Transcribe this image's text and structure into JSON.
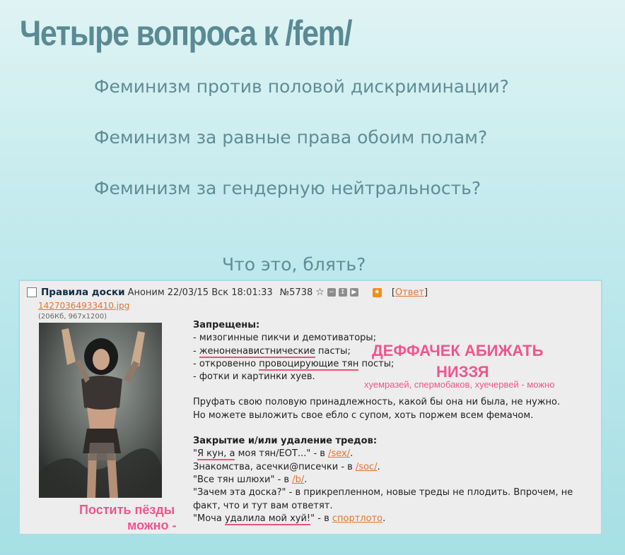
{
  "page": {
    "title": "Четыре вопроса к /fem/",
    "questions": [
      "Феминизм против половой дискриминации?",
      "Феминизм за равные права обоим полам?",
      "Феминизм за гендерную нейтральность?"
    ],
    "what_is_this": "Что это, блять?"
  },
  "post": {
    "subject": "Правила доски",
    "name": "Аноним",
    "datetime": "22/03/15 Вск 18:01:33",
    "number": "№5738",
    "reply_open": "[",
    "reply_label": "Ответ",
    "reply_close": "]",
    "file_name": "14270364933410.jpg",
    "file_meta": "(206Кб, 967x1200)",
    "icons": [
      "checkbox-icon",
      "star-icon",
      "hide-icon",
      "expand-icon",
      "play-icon",
      "favorite-icon"
    ],
    "body": {
      "forbidden_header": "Запрещены:",
      "f1": "- мизогинные пикчи и демотиваторы;",
      "f2a": "- ",
      "f2u": "женоненавистнические",
      "f2b": " пасты;",
      "f3a": "- откровенно ",
      "f3u": "провоцирующие тян",
      "f3b": " посты;",
      "f4": "- фотки и картинки хуев.",
      "para1": "Пруфать свою половую принадлежность, какой бы она ни была, не нужно.",
      "para2": "Но можете выложить свое ебло с супом, хоть поржем всем фемачом.",
      "closing_header": "Закрытие и/или удаление тредов:",
      "c1a": "\"",
      "c1u": "Я кун, а",
      "c1b": " моя тян/ЕОТ...\" - в ",
      "c1link": "/sex/",
      "c1end": ".",
      "c2a": "Знакомства, асечки@писечки - в ",
      "c2link": "/soc/",
      "c2end": ".",
      "c3a": "\"Все тян шлюхи\" - в ",
      "c3link": "/b/",
      "c3end": ".",
      "c4a": "\"Зачем эта доска?\" - в прикрепленном, новые треды не плодить. Впрочем, не",
      "c4b": "факт, что и тут вам ответят.",
      "c5a": "\"Моча ",
      "c5u": "удалила мой хуй!",
      "c5b": "\" - в ",
      "c5link": "спортлото",
      "c5end": "."
    }
  },
  "annotations": {
    "big1": "ДЕФФАЧЕК АБИЖАТЬ",
    "big2": "НИЗЗЯ",
    "small": "хуемразей, спермобаков, хуечервей - можно",
    "left1": "Постить пёзды",
    "left2": "можно -"
  },
  "colors": {
    "heading": "#5a8a93",
    "link": "#e8742e",
    "annotation": "#f0558c",
    "subject": "#0f2c47"
  }
}
